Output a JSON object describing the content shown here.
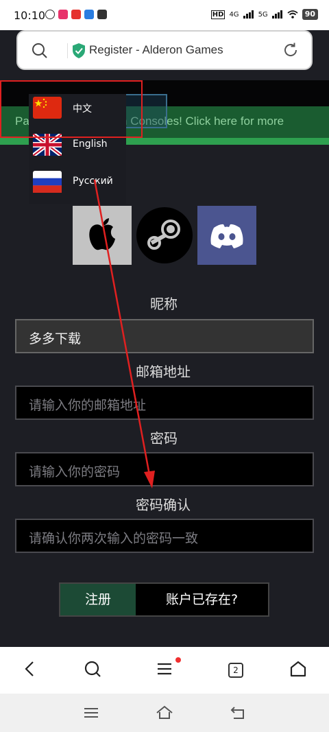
{
  "status_bar": {
    "time": "10:10",
    "hd_label": "HD",
    "net_4g": "4G",
    "net_5g": "5G",
    "battery": "90"
  },
  "address_bar": {
    "title": "Register - Alderon Games"
  },
  "banner": {
    "text": "Path of Titans now on Consoles! Click here for more"
  },
  "language_menu": {
    "items": [
      {
        "label": "中文"
      },
      {
        "label": "English"
      },
      {
        "label": "Русский"
      }
    ]
  },
  "form": {
    "nickname_label": "昵称",
    "nickname_value": "多多下载",
    "email_label": "邮箱地址",
    "email_placeholder": "请输入你的邮箱地址",
    "password_label": "密码",
    "password_placeholder": "请输入你的密码",
    "confirm_label": "密码确认",
    "confirm_placeholder": "请确认你两次输入的密码一致",
    "register_button": "注册",
    "login_button": "账户已存在?"
  },
  "bottom_nav": {
    "tab_count": "2"
  },
  "colors": {
    "accent_green": "#2ea04f",
    "annotation_red": "#e02020",
    "page_bg": "#1d1e24"
  }
}
